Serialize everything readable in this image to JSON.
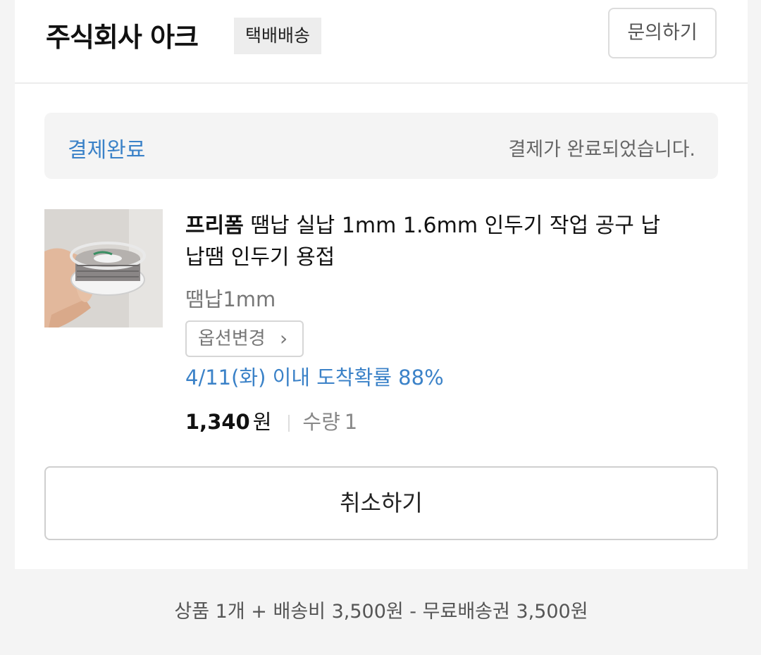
{
  "header": {
    "seller_name": "주식회사 아크",
    "shipping_badge": "택배배송",
    "inquiry_label": "문의하기"
  },
  "status": {
    "label": "결제완료",
    "message": "결제가 완료되었습니다."
  },
  "product": {
    "brand": "프리폼",
    "title": " 땜납 실납 1mm 1.6mm 인두기 작업 공구 납 납땜 인두기 용접",
    "option": "땜납1mm",
    "option_change_label": "옵션변경",
    "arrival_info": "4/11(화) 이내 도착확률 88%",
    "price": "1,340",
    "currency": "원",
    "quantity_label": "수량",
    "quantity": "1"
  },
  "actions": {
    "cancel_label": "취소하기"
  },
  "footer": {
    "summary": "상품 1개 + 배송비 3,500원 - 무료배송권 3,500원"
  },
  "colors": {
    "accent_blue": "#3b82c8",
    "background": "#f4f4f4"
  },
  "icons": {
    "option_chevron": "chevron-right-icon"
  }
}
